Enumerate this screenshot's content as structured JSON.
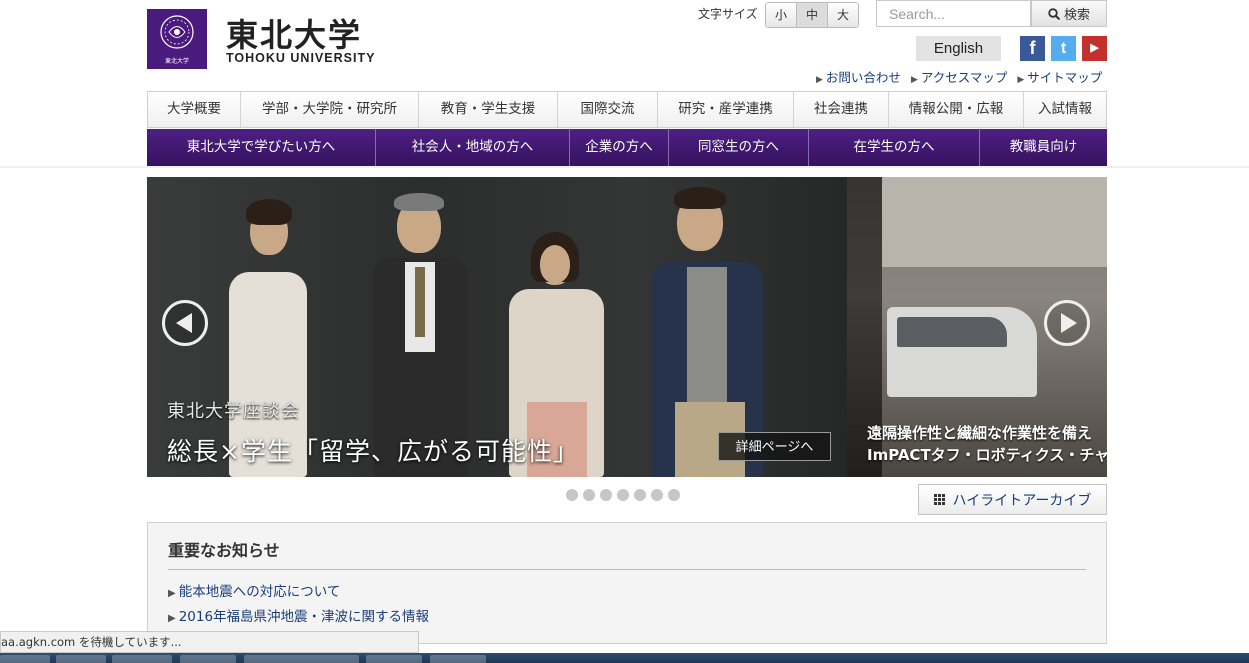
{
  "header": {
    "logo_jp": "東北大学",
    "logo_en": "TOHOKU UNIVERSITY",
    "logo_small": "東北大学",
    "font_size_label": "文字サイズ",
    "font_sizes": [
      "小",
      "中",
      "大"
    ],
    "font_size_active": "中",
    "search_placeholder": "Search...",
    "search_button": "検索",
    "english_button": "English",
    "social": {
      "facebook": "f",
      "twitter": "t",
      "youtube": "▶"
    },
    "util_links": [
      "お問い合わせ",
      "アクセスマップ",
      "サイトマップ"
    ]
  },
  "nav_primary": [
    "大学概要",
    "学部・大学院・研究所",
    "教育・学生支援",
    "国際交流",
    "研究・産学連携",
    "社会連携",
    "情報公開・広報",
    "入試情報"
  ],
  "nav_audience": [
    "東北大学で学びたい方へ",
    "社会人・地域の方へ",
    "企業の方へ",
    "同窓生の方へ",
    "在学生の方へ",
    "教職員向け"
  ],
  "slider": {
    "caption_sub": "東北大学座談会",
    "caption_main": "総長×学生「留学、広がる可能性」",
    "detail_button": "詳細ページへ",
    "side_caption_1": "遠隔操作性と繊細な作業性を備え",
    "side_caption_2": "ImPACTタフ・ロボティクス・チャ",
    "dot_count": 7
  },
  "archive_button": "ハイライトアーカイブ",
  "notice": {
    "title": "重要なお知らせ",
    "items": [
      "能本地震への対応について",
      "2016年福島県沖地震・津波に関する情報"
    ]
  },
  "status_bar": "aa.agkn.com を待機しています...",
  "colors": {
    "brand_purple": "#4b1a7e",
    "link_blue": "#1a3c78"
  }
}
